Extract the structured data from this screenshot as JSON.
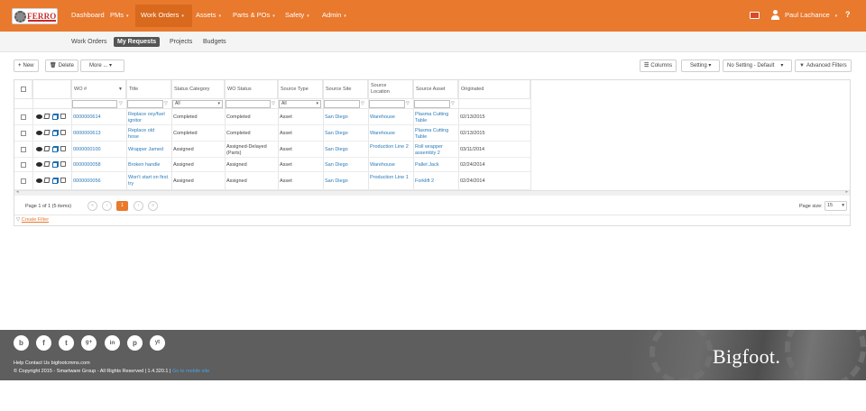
{
  "brand": {
    "logo_text": "FERRO"
  },
  "nav": {
    "items": [
      {
        "label": "Dashboard",
        "caret": ""
      },
      {
        "label": "PMs",
        "caret": "▾"
      },
      {
        "label": "Work Orders",
        "caret": "▾"
      },
      {
        "label": "Assets",
        "caret": "▾"
      },
      {
        "label": "Parts & POs",
        "caret": "▾"
      },
      {
        "label": "Safety",
        "caret": "▾"
      },
      {
        "label": "Admin",
        "caret": "▾"
      }
    ],
    "active_index": 2,
    "user_name": "Paul Lachance",
    "user_caret": "▾",
    "help": "?",
    "accent_color": "#e8792d"
  },
  "subtabs": [
    "Work Orders",
    "My Requests",
    "Projects",
    "Budgets"
  ],
  "subtabs_active": 1,
  "toolbar": {
    "new_label": "New",
    "delete_label": "Delete",
    "more_label": "More ... ▾",
    "columns_label": "Columns",
    "setting_label": "Setting ▾",
    "no_setting_label": "No Setting - Default",
    "advanced_filters_label": "Advanced Filters"
  },
  "grid": {
    "columns": [
      "WO #",
      "Title",
      "Status Category",
      "WO Status",
      "Source Type",
      "Source Site",
      "Source Location",
      "Source Asset",
      "Originated"
    ],
    "filters": {
      "status_category": "All",
      "source_type": "All"
    },
    "rows": [
      {
        "wo": "0000000614",
        "title": "Replace oxy/fuel ignitor",
        "status_category": "Completed",
        "wo_status": "Completed",
        "source_type": "Asset",
        "site": "San Diego",
        "location": "Warehouse",
        "asset": "Plasma Cutting Table",
        "originated": "02/13/2015"
      },
      {
        "wo": "0000000613",
        "title": "Replace old hose",
        "status_category": "Completed",
        "wo_status": "Completed",
        "source_type": "Asset",
        "site": "San Diego",
        "location": "Warehouse",
        "asset": "Plasma Cutting Table",
        "originated": "02/13/2015"
      },
      {
        "wo": "0000000100",
        "title": "Wrapper Jamed",
        "status_category": "Assigned",
        "wo_status": "Assigned-Delayed (Parts)",
        "source_type": "Asset",
        "site": "San Diego",
        "location": "Production Line 2",
        "asset": "Roll wrapper assembly 2",
        "originated": "03/11/2014"
      },
      {
        "wo": "0000000058",
        "title": "Broken handle",
        "status_category": "Assigned",
        "wo_status": "Assigned",
        "source_type": "Asset",
        "site": "San Diego",
        "location": "Warehouse",
        "asset": "Pallet Jack",
        "originated": "02/24/2014"
      },
      {
        "wo": "0000000056",
        "title": "Won't start on first try",
        "status_category": "Assigned",
        "wo_status": "Assigned",
        "source_type": "Asset",
        "site": "San Diego",
        "location": "Production Line 1",
        "asset": "Forklift 2",
        "originated": "02/24/2014"
      }
    ]
  },
  "pager": {
    "info": "Page 1 of 1 (5 items)",
    "current_page": "1",
    "page_size_label": "Page size:",
    "page_size": "15"
  },
  "create_filter_label": "Create Filter",
  "footer": {
    "social": [
      "b",
      "f",
      "t",
      "g+",
      "in",
      "p",
      "yt"
    ],
    "links": "Help   Contact Us   bigfootcmms.com",
    "copyright": "© Copyright 2015 - Smartware Group - All Rights Reserved | 1.4.320.1 | ",
    "mobile_link": "Go to mobile site",
    "brand": "Bigfoot."
  }
}
